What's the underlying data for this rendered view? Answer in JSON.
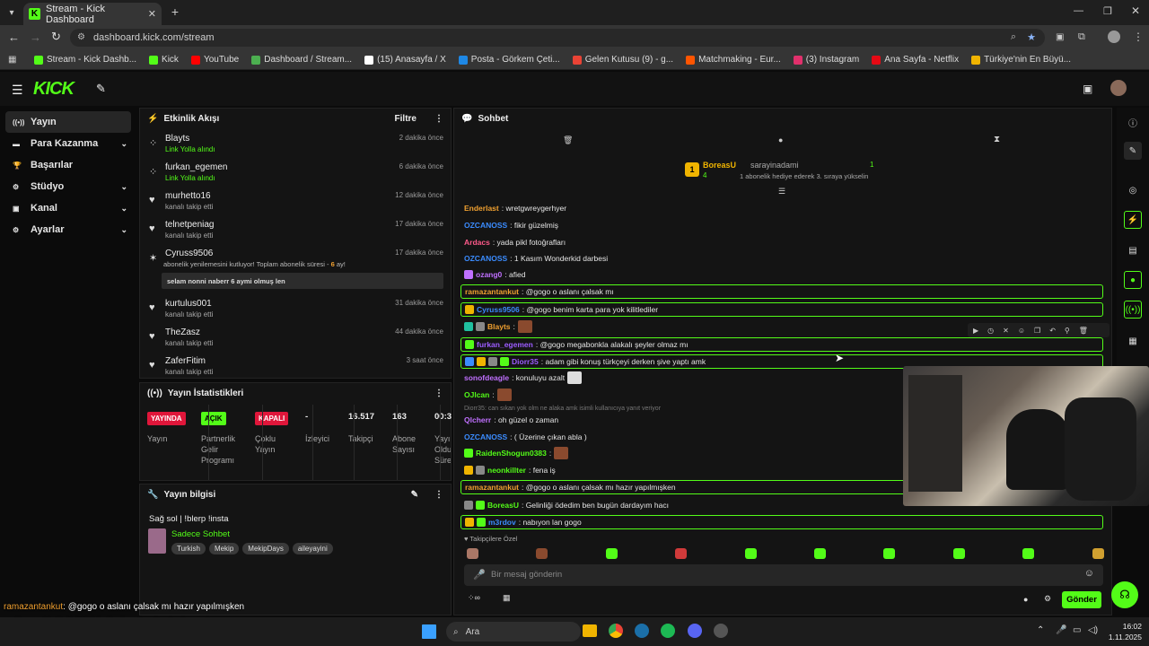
{
  "browser": {
    "tab_title": "Stream - Kick Dashboard",
    "url": "dashboard.kick.com/stream",
    "bookmarks": [
      {
        "label": "Stream - Kick Dashb...",
        "color": "#53fc18"
      },
      {
        "label": "Kick",
        "color": "#53fc18"
      },
      {
        "label": "YouTube",
        "color": "#ff0000"
      },
      {
        "label": "Dashboard / Stream...",
        "color": "#4caf50"
      },
      {
        "label": "(15) Anasayfa / X",
        "color": "#ffffff"
      },
      {
        "label": "Posta - Görkem Çeti...",
        "color": "#1e88e5"
      },
      {
        "label": "Gelen Kutusu (9) - g...",
        "color": "#ea4335"
      },
      {
        "label": "Matchmaking - Eur...",
        "color": "#ff5500"
      },
      {
        "label": "(3) Instagram",
        "color": "#e1306c"
      },
      {
        "label": "Ana Sayfa - Netflix",
        "color": "#e50914"
      },
      {
        "label": "Türkiye'nin En Büyü...",
        "color": "#f0b400"
      }
    ]
  },
  "kick": {
    "logo": "KICK"
  },
  "sidebar": {
    "items": [
      {
        "label": "Yayın",
        "icon": "broadcast-icon",
        "active": true
      },
      {
        "label": "Para Kazanma",
        "icon": "money-icon",
        "chevron": true
      },
      {
        "label": "Başarılar",
        "icon": "trophy-icon"
      },
      {
        "label": "Stüdyo",
        "icon": "gear-icon",
        "chevron": true
      },
      {
        "label": "Kanal",
        "icon": "user-icon",
        "chevron": true
      },
      {
        "label": "Ayarlar",
        "icon": "gear-icon",
        "chevron": true
      }
    ]
  },
  "activity": {
    "title": "Etkinlik Akışı",
    "filter": "Filtre",
    "events": [
      {
        "name": "Blayts",
        "sub": "Link Yolla alındı",
        "time": "2 dakika önce",
        "green": true,
        "icon": "gift"
      },
      {
        "name": "furkan_egemen",
        "sub": "Link Yolla alındı",
        "time": "6 dakika önce",
        "green": true,
        "icon": "gift"
      },
      {
        "name": "murhetto16",
        "sub": "kanalı takip etti",
        "time": "12 dakika önce",
        "icon": "heart"
      },
      {
        "name": "telnetpeniag",
        "sub": "kanalı takip etti",
        "time": "17 dakika önce",
        "icon": "heart"
      },
      {
        "name": "kurtulus001",
        "sub": "kanalı takip etti",
        "time": "31 dakika önce",
        "icon": "heart"
      },
      {
        "name": "TheZasz",
        "sub": "kanalı takip etti",
        "time": "44 dakika önce",
        "icon": "heart"
      },
      {
        "name": "ZaferFitim",
        "sub": "kanalı takip etti",
        "time": "3 saat önce",
        "icon": "heart"
      }
    ],
    "sub_event": {
      "name": "Cyruss9506",
      "time": "17 dakika önce",
      "text_a": "abonelik yenilemesini kutluyor! Toplam abonelik süresi - ",
      "months": "6",
      "text_b": " ay!",
      "message": "selam nonni naberr 6 aymi olmuş len"
    }
  },
  "stats": {
    "title": "Yayın İstatistikleri",
    "cols": [
      {
        "badge": "YAYINDA",
        "badge_color": "#e0163a",
        "label": "Yayın"
      },
      {
        "badge": "AÇIK",
        "badge_color": "#53fc18",
        "label": "Partnerlik Gelir Programı"
      },
      {
        "badge": "KAPALI",
        "badge_color": "#e0163a",
        "label": "Çoklu Yayın"
      },
      {
        "value": "-",
        "label": "İzleyici"
      },
      {
        "value": "16.517",
        "label": "Takipçi"
      },
      {
        "value": "163",
        "label": "Abone Sayısı"
      },
      {
        "value": "00:3",
        "label": "Yayın Oldu Süre"
      }
    ]
  },
  "stream_info": {
    "title": "Yayın bilgisi",
    "stream_title": "Sağ sol | !blerp !insta",
    "category": "Sadece Sohbet",
    "tags": [
      "Turkish",
      "Mekip",
      "MekipDays",
      "aileyayini"
    ]
  },
  "chat": {
    "title": "Sohbet",
    "pinned": {
      "rank": "1",
      "user": "BoreasU",
      "count": "4",
      "other": "sarayinadami",
      "other_count": "1",
      "note": "1 abonelik hediye ederek 3. sıraya yükselin"
    },
    "messages": [
      {
        "user": "Enderlast",
        "color": "#f0a030",
        "text": ": wretgwreygerhyer"
      },
      {
        "user": "OZCANOSS",
        "color": "#3b8cff",
        "text": ": fikir güzelmiş"
      },
      {
        "user": "Ardacs",
        "color": "#ff5a8a",
        "text": ": yada pikl fotoğrafları"
      },
      {
        "user": "OZCANOSS",
        "color": "#3b8cff",
        "text": ": 1 Kasım Wonderkid darbesi"
      },
      {
        "user": "ozang0",
        "color": "#c070ff",
        "text": ": afied"
      },
      {
        "user": "ramazantankut",
        "color": "#f0a030",
        "text": ": @gogo o aslanı çalsak mı",
        "box": true
      },
      {
        "user": "Cyruss9506",
        "color": "#3b8cff",
        "text": ": @gogo benim karta para yok kilitlediler",
        "box": true
      },
      {
        "user": "Blayts",
        "color": "#f0a030",
        "text": ":"
      },
      {
        "user": "furkan_egemen",
        "color": "#9c5cff",
        "text": ": @gogo megabonkla alakalı şeyler olmaz mı",
        "box": true
      },
      {
        "user": "Diorr35",
        "color": "#9c5cff",
        "text": ": adam gibi konuş türkçeyi derken şive yaptı amk",
        "box": true
      },
      {
        "user": "sonofdeagle",
        "color": "#c070ff",
        "text": ": konuluyu azalt"
      },
      {
        "user": "OJlcan",
        "color": "#53fc18",
        "text": ":"
      },
      {
        "reply": "Diorr35: can sıkan yok olm ne alaka amk isimli kullanıcıya yanıt veriyor",
        "user": "Qlcherr",
        "color": "#c070ff",
        "text": ": oh güzel o zaman"
      },
      {
        "user": "OZCANOSS",
        "color": "#3b8cff",
        "text": ": ( Üzerine çıkan abla )"
      },
      {
        "user": "RaidenShogun0383",
        "color": "#53fc18",
        "text": ":"
      },
      {
        "user": "neonkillter",
        "color": "#53fc18",
        "text": ": fena iş"
      },
      {
        "user": "ramazantankut",
        "color": "#f0a030",
        "text": ": @gogo o aslanı çalsak mı hazır yapılmışken",
        "box": true
      },
      {
        "user": "BoreasU",
        "color": "#53fc18",
        "text": ": Gelinliği ödedim ben bugün dardayım hacı"
      },
      {
        "user": "m3rdov",
        "color": "#3b8cff",
        "text": ": nabıyon lan gogo",
        "box": true
      }
    ],
    "followers_only": "Takipçilere Özel",
    "placeholder": "Bir mesaj gönderin",
    "send": "Gönder"
  },
  "overlay": [
    {
      "user": "ramazantankut",
      "color": "#f0a030",
      "text": ": @gogo o aslanı çalsak mı hazır yapılmışken"
    },
    {
      "user": "BoreasU",
      "color": "#53fc18",
      "text": ": Gelinliği ödedim ben bugün dardayım hacı"
    },
    {
      "user": "m3rdov",
      "color": "#3b8cff",
      "text": ": nabıyon lan gogo"
    }
  ],
  "taskbar": {
    "search": "Ara",
    "time": "16:02",
    "date": "1.11.2025"
  }
}
